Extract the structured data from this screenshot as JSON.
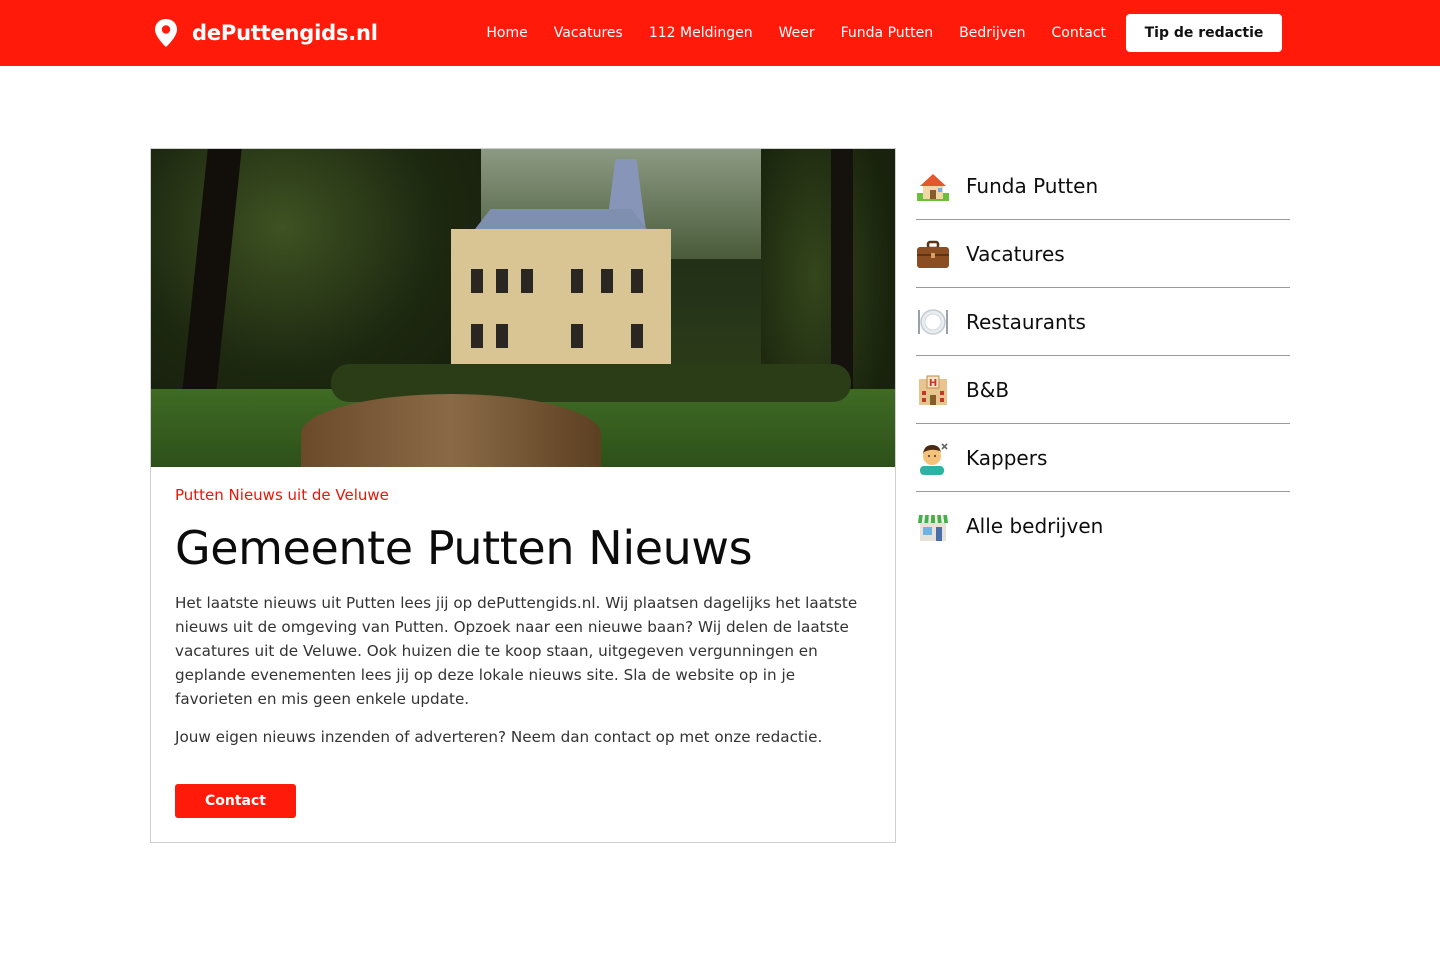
{
  "header": {
    "logo_icon": "location-pin-icon",
    "site_name": "dePuttengids.nl",
    "nav": [
      {
        "label": "Home"
      },
      {
        "label": "Vacatures"
      },
      {
        "label": "112 Meldingen"
      },
      {
        "label": "Weer"
      },
      {
        "label": "Funda Putten"
      },
      {
        "label": "Bedrijven"
      },
      {
        "label": "Contact"
      }
    ],
    "cta_label": "Tip de redactie"
  },
  "article": {
    "kicker": "Putten Nieuws uit de Veluwe",
    "title": "Gemeente Putten Nieuws",
    "paragraphs": [
      "Het laatste nieuws uit Putten lees jij op dePuttengids.nl. Wij plaatsen dagelijks het laatste nieuws uit de omgeving van Putten. Opzoek naar een nieuwe baan? Wij delen de laatste vacatures uit de Veluwe. Ook huizen die te koop staan, uitgegeven vergunningen en geplande evenementen lees jij op deze lokale nieuws site. Sla de website op in je favorieten en mis geen enkele update.",
      "Jouw eigen nieuws inzenden of adverteren? Neem dan contact op met onze redactie."
    ],
    "button_label": "Contact"
  },
  "sidebar": {
    "items": [
      {
        "label": "Funda Putten",
        "icon": "house-icon"
      },
      {
        "label": "Vacatures",
        "icon": "briefcase-icon"
      },
      {
        "label": "Restaurants",
        "icon": "plate-cutlery-icon"
      },
      {
        "label": "B&B",
        "icon": "hotel-icon"
      },
      {
        "label": "Kappers",
        "icon": "haircut-icon"
      },
      {
        "label": "Alle bedrijven",
        "icon": "shop-icon"
      }
    ]
  },
  "colors": {
    "brand": "#ff1a0a",
    "kicker": "#e8170a",
    "text": "#333333"
  }
}
